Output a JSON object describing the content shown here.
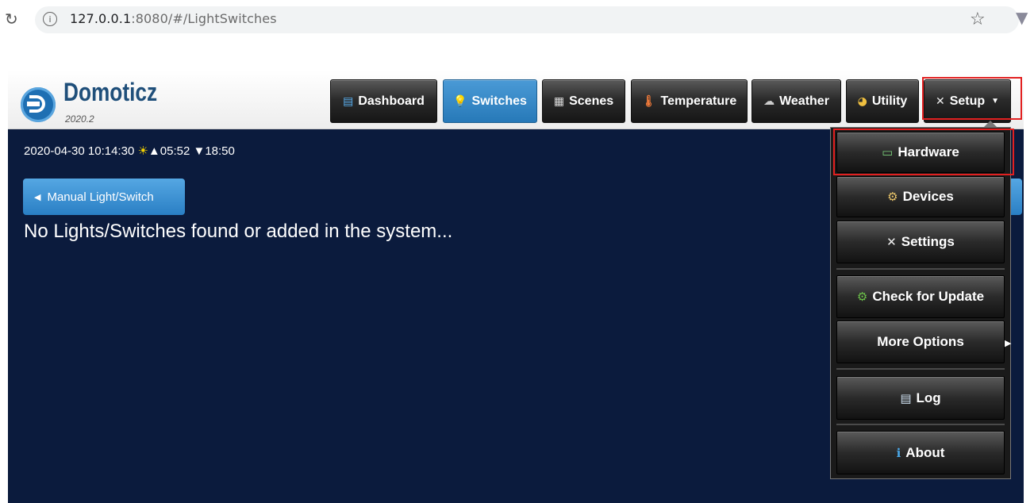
{
  "browser": {
    "url_host": "127.0.0.1",
    "url_path": ":8080/#/LightSwitches",
    "reload_icon": "reload-icon",
    "info_icon": "info-icon",
    "star_icon": "star-icon"
  },
  "app": {
    "brand": "Domoticz",
    "version": "2020.2"
  },
  "nav": [
    {
      "label": "Dashboard",
      "icon": "dashboard-icon"
    },
    {
      "label": "Switches",
      "icon": "lightbulb-icon",
      "active": true
    },
    {
      "label": "Scenes",
      "icon": "clapper-icon"
    },
    {
      "label": "Temperature",
      "icon": "thermometer-icon"
    },
    {
      "label": "Weather",
      "icon": "cloud-icon"
    },
    {
      "label": "Utility",
      "icon": "utility-icon"
    },
    {
      "label": "Setup",
      "icon": "tools-icon"
    }
  ],
  "status": {
    "datetime": "2020-04-30 10:14:30",
    "sunrise": "▲05:52",
    "sunset": "▼18:50"
  },
  "main": {
    "back_button": "Manual Light/Switch",
    "empty_message": "No Lights/Switches found or added in the system..."
  },
  "setup_menu": [
    {
      "label": "Hardware",
      "icon": "hardware-icon"
    },
    {
      "label": "Devices",
      "icon": "gear-icon"
    },
    {
      "label": "Settings",
      "icon": "tools-icon"
    },
    {
      "label": "Check for Update",
      "icon": "update-gear-icon"
    },
    {
      "label": "More Options",
      "icon": "",
      "submenu": true
    },
    {
      "label": "Log",
      "icon": "log-icon"
    },
    {
      "label": "About",
      "icon": "info-icon"
    }
  ],
  "colors": {
    "main_bg": "#0b1b3d",
    "active_tab": "#2f86c7",
    "highlight": "#e22020"
  }
}
